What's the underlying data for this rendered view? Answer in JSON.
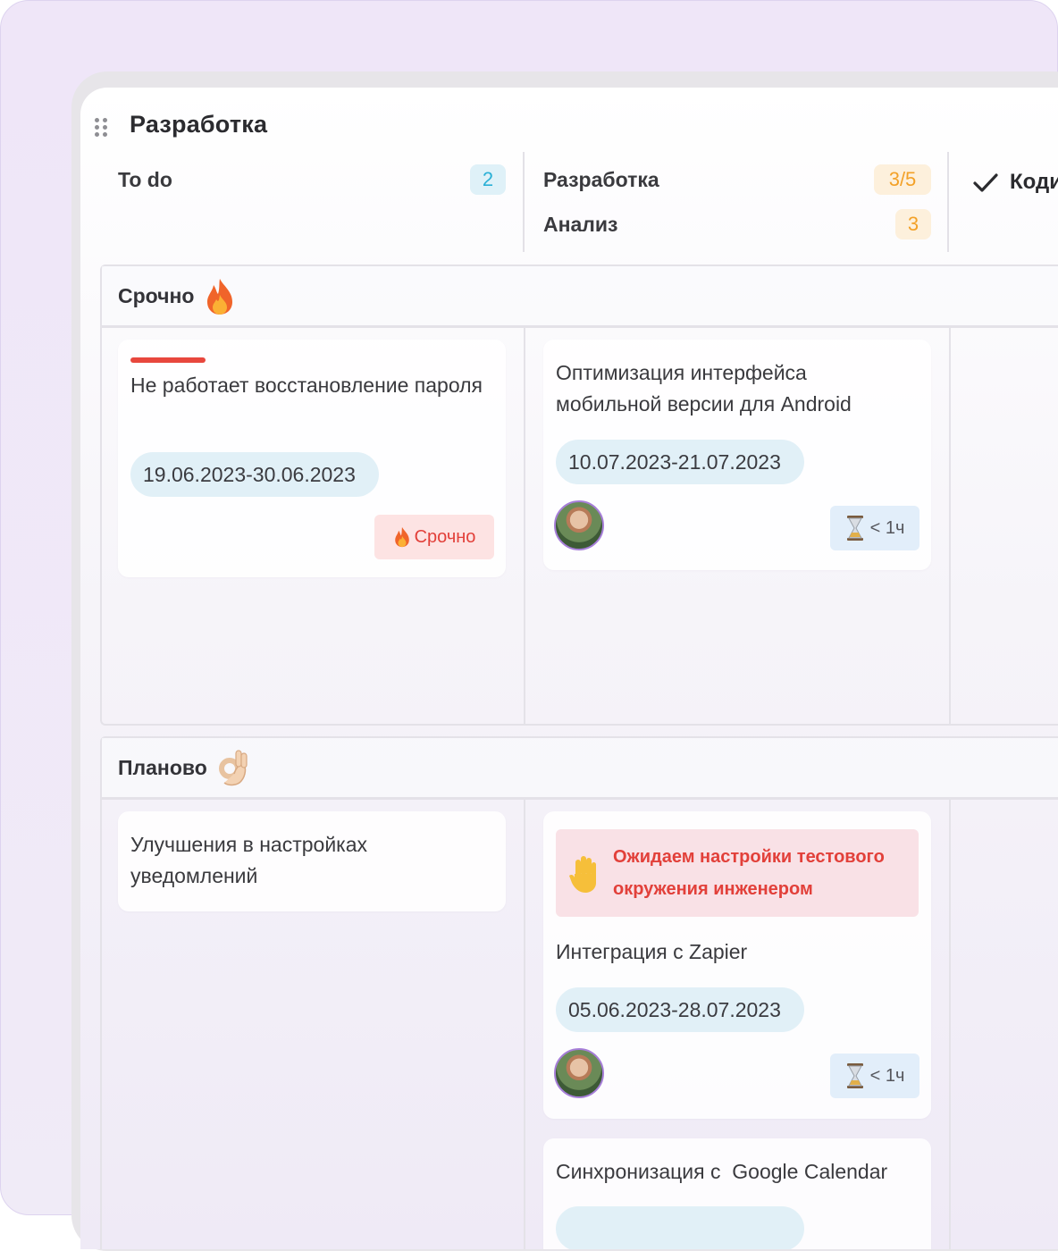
{
  "board": {
    "title": "Разработка",
    "columns": [
      {
        "label": "To do",
        "count": "2"
      },
      {
        "label": "Разработка",
        "count": "3/5",
        "sub_label": "Анализ",
        "sub_count": "3"
      },
      {
        "label": "Коди"
      }
    ]
  },
  "lanes": [
    {
      "title": "Срочно",
      "icon": "fire-icon",
      "cards": [
        {
          "title": "Не работает восстановление пароля",
          "date": "19.06.2023-30.06.2023",
          "tag": "Срочно",
          "accent": "#e8473d"
        },
        {
          "title": "Оптимизация интерфейса мобильной версии для Android",
          "date": "10.07.2023-21.07.2023",
          "time": "< 1ч"
        }
      ]
    },
    {
      "title": "Планово",
      "icon": "ok-hand-icon",
      "cards": [
        {
          "title": "Улучшения в настройках уведомлений"
        },
        {
          "warning": "Ожидаем настройки тестового окружения инженером",
          "title": "Интеграция с Zapier",
          "date": "05.06.2023-28.07.2023",
          "time": "< 1ч"
        },
        {
          "title": "Синхронизация с  Google Calendar"
        }
      ]
    }
  ]
}
